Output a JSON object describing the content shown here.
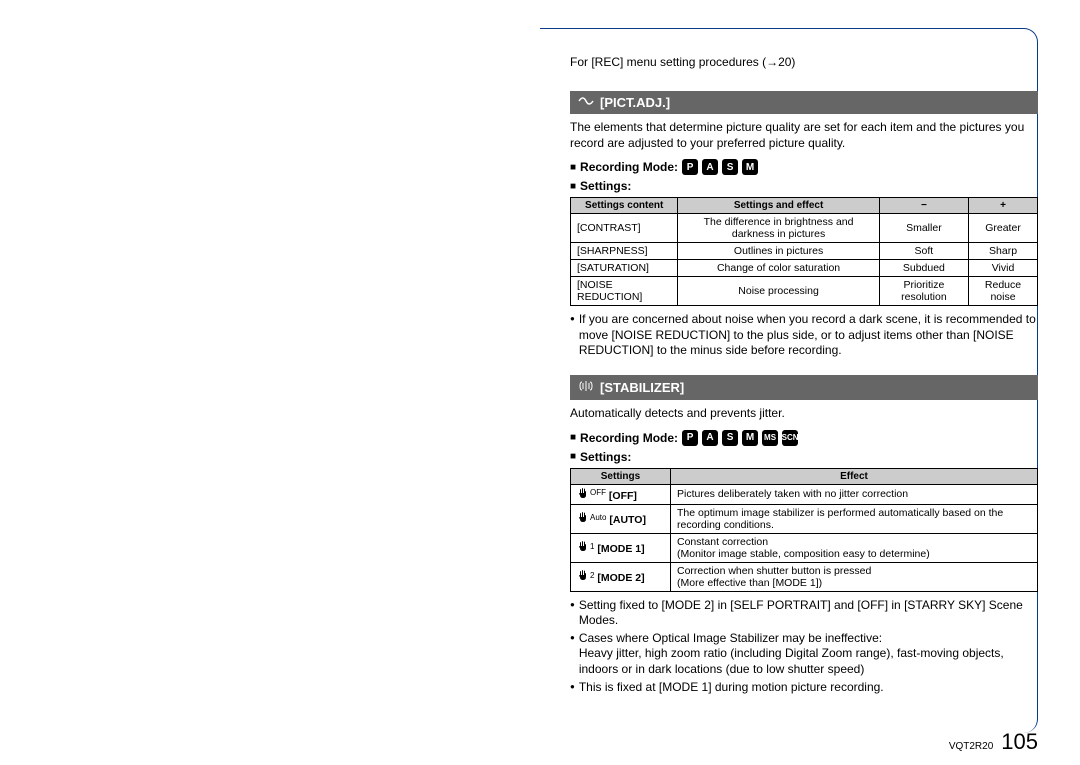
{
  "top_note": "For [REC] menu setting procedures (→20)",
  "section1": {
    "title": "[PICT.ADJ.]",
    "descr": "The elements that determine picture quality are set for each item and the pictures you record are adjusted to your preferred picture quality.",
    "rec_mode_label": "Recording Mode:",
    "modes": [
      "P",
      "A",
      "S",
      "M"
    ],
    "settings_label": "Settings:",
    "table": {
      "headers": [
        "Settings content",
        "Settings and effect",
        "−",
        "+"
      ],
      "rows": [
        [
          "[CONTRAST]",
          "The difference in brightness and darkness in pictures",
          "Smaller",
          "Greater"
        ],
        [
          "[SHARPNESS]",
          "Outlines in pictures",
          "Soft",
          "Sharp"
        ],
        [
          "[SATURATION]",
          "Change of color saturation",
          "Subdued",
          "Vivid"
        ],
        [
          "[NOISE REDUCTION]",
          "Noise processing",
          "Prioritize resolution",
          "Reduce noise"
        ]
      ]
    },
    "notes": [
      "If you are concerned about noise when you record a dark scene, it is recommended to move [NOISE REDUCTION] to the plus side, or to adjust items other than [NOISE REDUCTION] to the minus side before recording."
    ]
  },
  "section2": {
    "title": "[STABILIZER]",
    "descr": "Automatically detects and prevents jitter.",
    "rec_mode_label": "Recording Mode:",
    "modes": [
      "P",
      "A",
      "S",
      "M",
      "MS",
      "SCN"
    ],
    "settings_label": "Settings:",
    "table": {
      "headers": [
        "Settings",
        "Effect"
      ],
      "rows": [
        {
          "iconsub": "OFF",
          "label": "[OFF]",
          "effect": "Pictures deliberately taken with no jitter correction"
        },
        {
          "iconsub": "Auto",
          "label": "[AUTO]",
          "effect": "The optimum image stabilizer is performed automatically based on the recording conditions."
        },
        {
          "iconsub": "1",
          "label": "[MODE 1]",
          "effect": "Constant correction\n(Monitor image stable, composition easy to determine)"
        },
        {
          "iconsub": "2",
          "label": "[MODE 2]",
          "effect": "Correction when shutter button is pressed\n(More effective than [MODE 1])"
        }
      ]
    },
    "notes": [
      "Setting fixed to [MODE 2] in [SELF PORTRAIT] and [OFF] in [STARRY SKY] Scene Modes.",
      "Cases where Optical Image Stabilizer may be ineffective:\nHeavy jitter, high zoom ratio (including Digital Zoom range), fast-moving objects, indoors or in dark locations (due to low shutter speed)",
      "This is fixed at [MODE 1] during motion picture recording."
    ]
  },
  "footer": {
    "code": "VQT2R20",
    "page": "105"
  }
}
